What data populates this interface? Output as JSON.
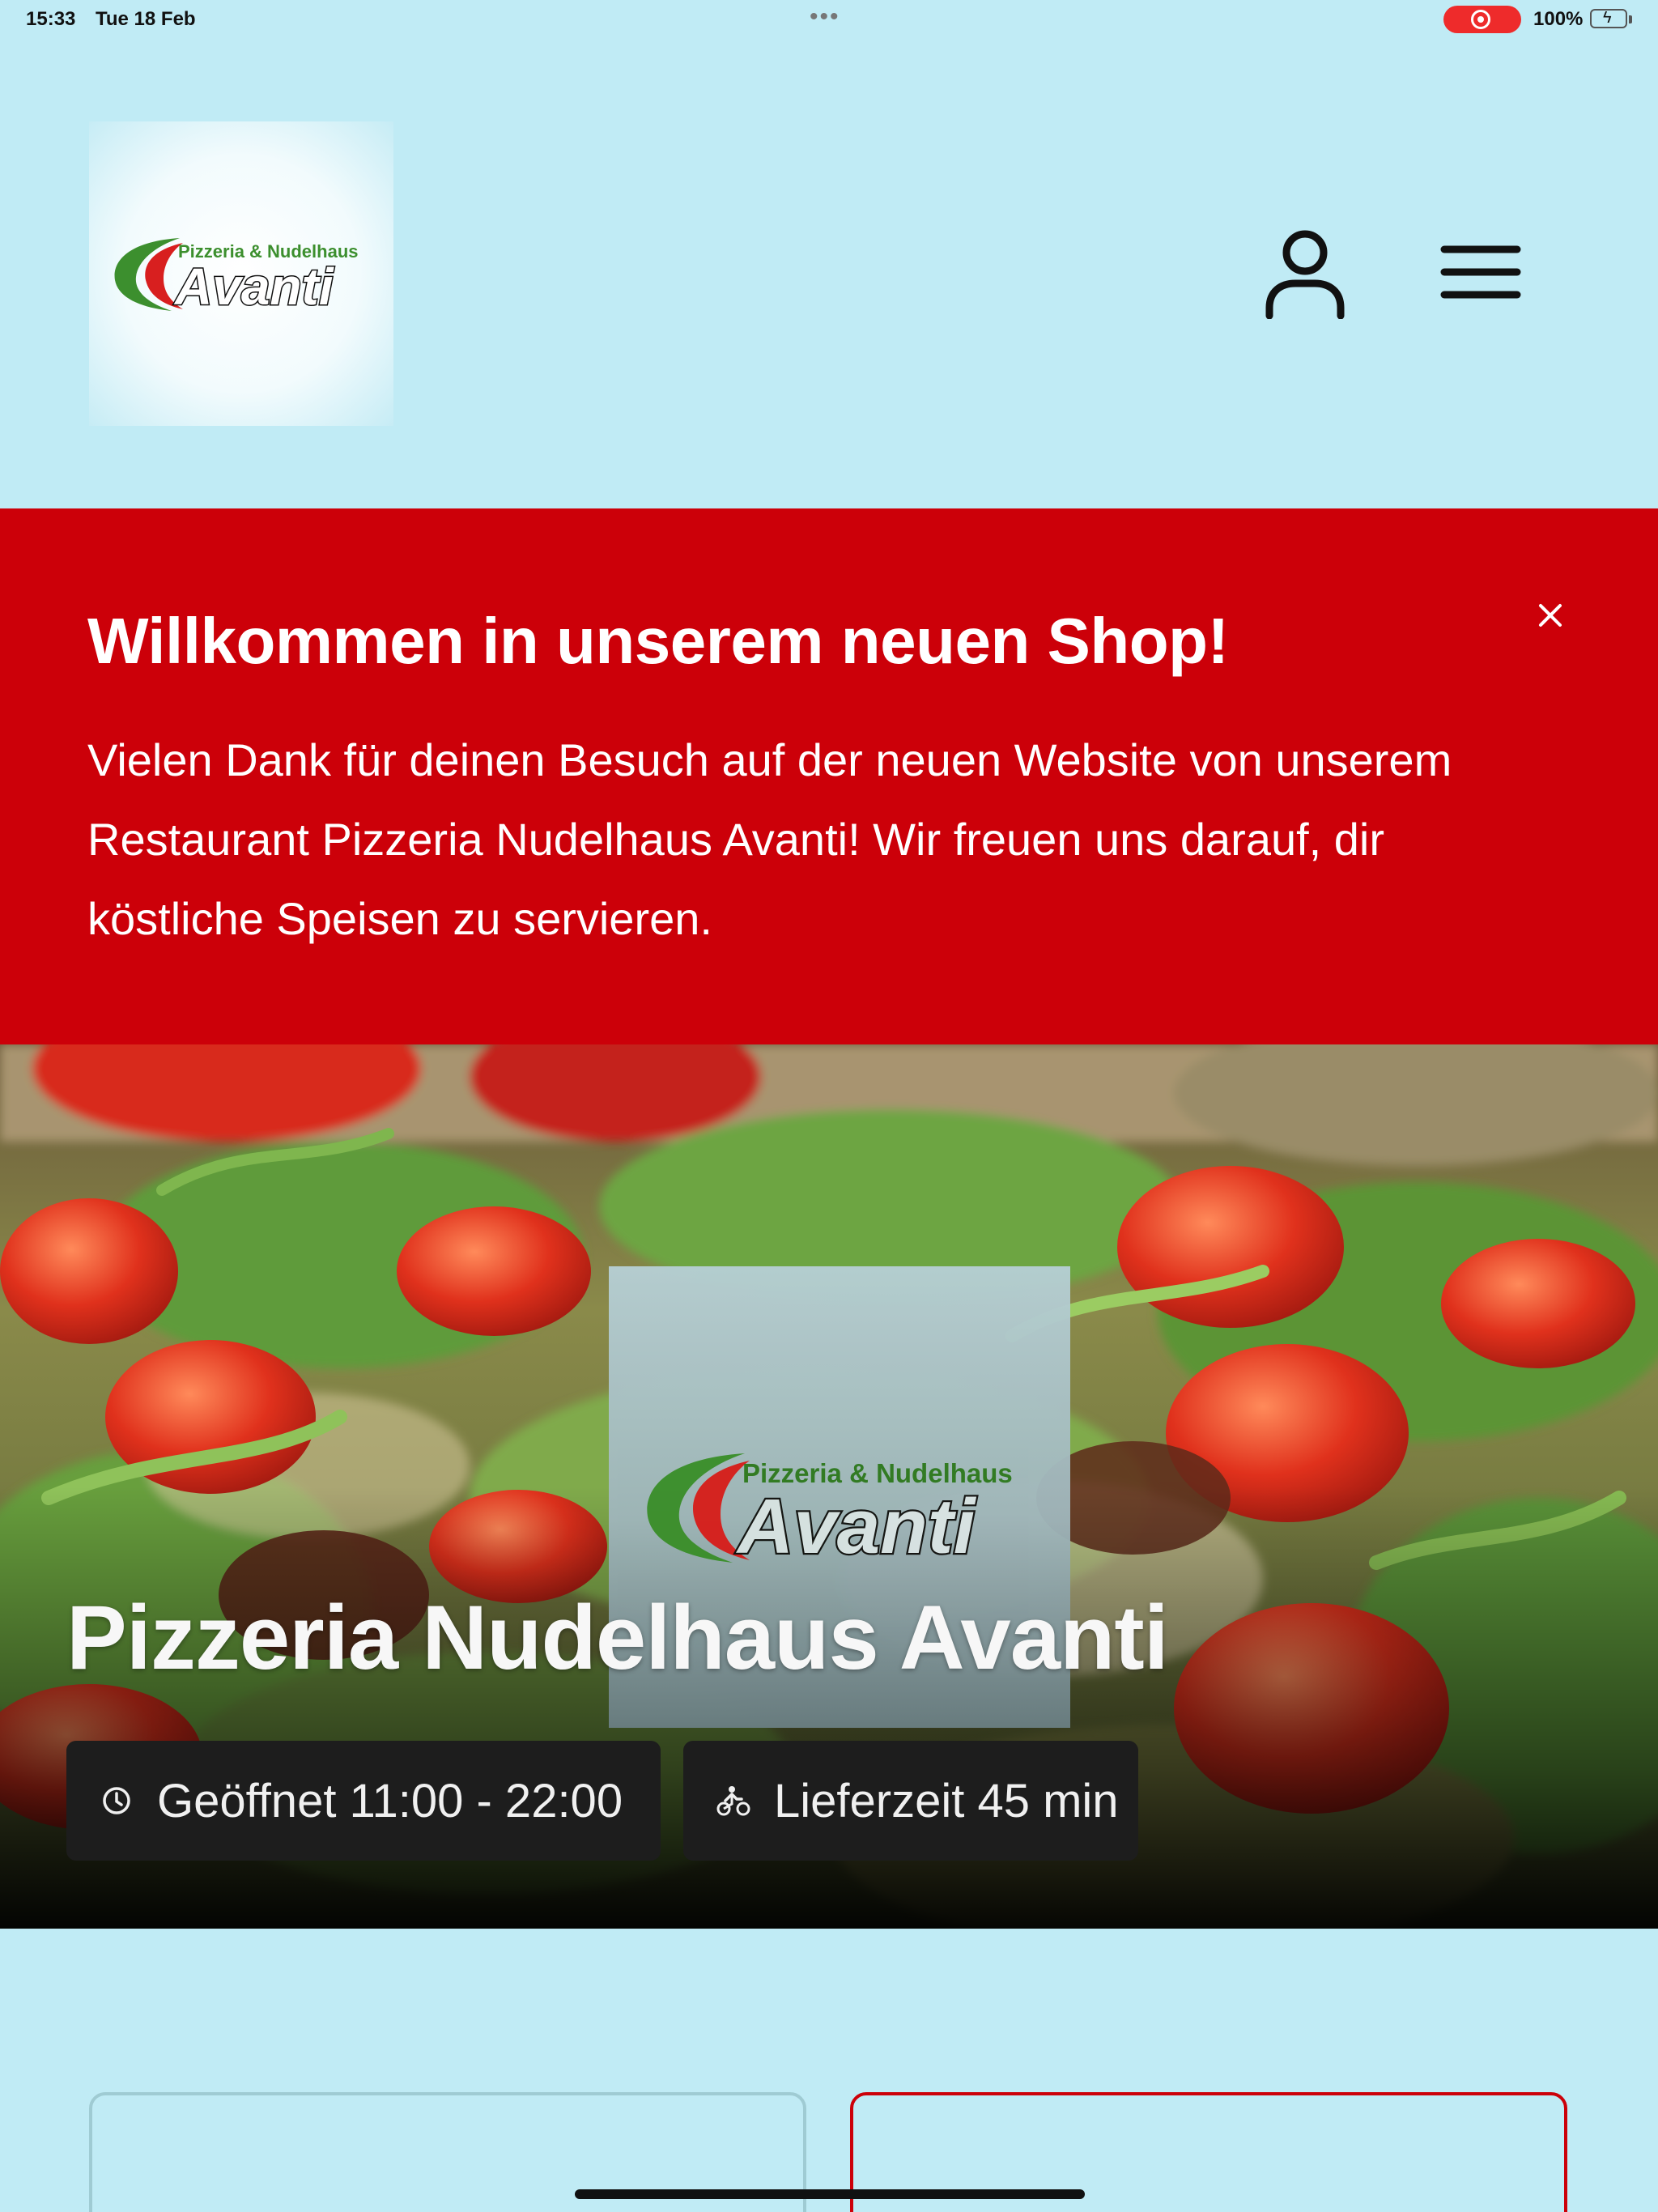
{
  "status_bar": {
    "time": "15:33",
    "date": "Tue 18 Feb",
    "battery": "100%"
  },
  "header": {
    "logo": {
      "tagline": "Pizzeria & Nudelhaus",
      "name": "Avanti"
    },
    "user_icon": "user-icon",
    "menu_icon": "hamburger-menu-icon"
  },
  "banner": {
    "title": "Willkommen in unserem neuen Shop!",
    "text": "Vielen Dank für deinen Besuch auf der neuen Website von unserem Restaurant Pizzeria Nudelhaus Avanti! Wir freuen uns darauf, dir köstliche Speisen zu servieren.",
    "close_icon": "close-icon",
    "background": "#cc0009"
  },
  "hero": {
    "title": "Pizzeria Nudelhaus Avanti",
    "opening_hours": "Geöffnet 11:00 - 22:00",
    "delivery_time": "Lieferzeit 45 min",
    "clock_icon": "clock-icon",
    "delivery_icon": "bicycle-courier-icon"
  },
  "colors": {
    "page_background": "#c0ebf5",
    "accent_red": "#cc0009",
    "chip_background": "#1d1d1d"
  }
}
